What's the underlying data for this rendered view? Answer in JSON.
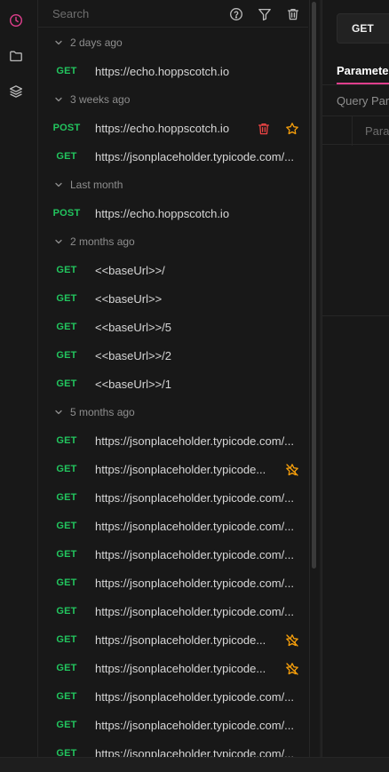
{
  "colors": {
    "accent": "#e03f8d",
    "method_green": "#22c55e",
    "danger": "#ef4444",
    "star": "#f59e0b"
  },
  "rail": {
    "icons": [
      "clock-icon",
      "folder-icon",
      "layers-icon"
    ]
  },
  "search": {
    "placeholder": "Search"
  },
  "toolbar": {
    "icons": [
      "help-icon",
      "filter-icon",
      "trash-icon"
    ]
  },
  "history": [
    {
      "label": "2 days ago",
      "entries": [
        {
          "method": "GET",
          "url": "https://echo.hoppscotch.io",
          "actions": []
        }
      ]
    },
    {
      "label": "3 weeks ago",
      "entries": [
        {
          "method": "POST",
          "url": "https://echo.hoppscotch.io",
          "actions": [
            "delete",
            "star"
          ]
        },
        {
          "method": "GET",
          "url": "https://jsonplaceholder.typicode.com/...",
          "actions": []
        }
      ]
    },
    {
      "label": "Last month",
      "entries": [
        {
          "method": "POST",
          "url": "https://echo.hoppscotch.io",
          "actions": []
        }
      ]
    },
    {
      "label": "2 months ago",
      "entries": [
        {
          "method": "GET",
          "url": "<<baseUrl>>/",
          "actions": []
        },
        {
          "method": "GET",
          "url": "<<baseUrl>>",
          "actions": []
        },
        {
          "method": "GET",
          "url": "<<baseUrl>>/5",
          "actions": []
        },
        {
          "method": "GET",
          "url": "<<baseUrl>>/2",
          "actions": []
        },
        {
          "method": "GET",
          "url": "<<baseUrl>>/1",
          "actions": []
        }
      ]
    },
    {
      "label": "5 months ago",
      "entries": [
        {
          "method": "GET",
          "url": "https://jsonplaceholder.typicode.com/...",
          "actions": []
        },
        {
          "method": "GET",
          "url": "https://jsonplaceholder.typicode...",
          "actions": [
            "unstar"
          ]
        },
        {
          "method": "GET",
          "url": "https://jsonplaceholder.typicode.com/...",
          "actions": []
        },
        {
          "method": "GET",
          "url": "https://jsonplaceholder.typicode.com/...",
          "actions": []
        },
        {
          "method": "GET",
          "url": "https://jsonplaceholder.typicode.com/...",
          "actions": []
        },
        {
          "method": "GET",
          "url": "https://jsonplaceholder.typicode.com/...",
          "actions": []
        },
        {
          "method": "GET",
          "url": "https://jsonplaceholder.typicode.com/...",
          "actions": []
        },
        {
          "method": "GET",
          "url": "https://jsonplaceholder.typicode...",
          "actions": [
            "unstar"
          ]
        },
        {
          "method": "GET",
          "url": "https://jsonplaceholder.typicode...",
          "actions": [
            "unstar"
          ]
        },
        {
          "method": "GET",
          "url": "https://jsonplaceholder.typicode.com/...",
          "actions": []
        },
        {
          "method": "GET",
          "url": "https://jsonplaceholder.typicode.com/...",
          "actions": []
        },
        {
          "method": "GET",
          "url": "https://jsonplaceholder.typicode.com/...",
          "actions": []
        }
      ]
    }
  ],
  "main": {
    "method_value": "GET",
    "tab_label": "Parameters",
    "query_label": "Query Parameters",
    "table_header": "Parameter"
  }
}
